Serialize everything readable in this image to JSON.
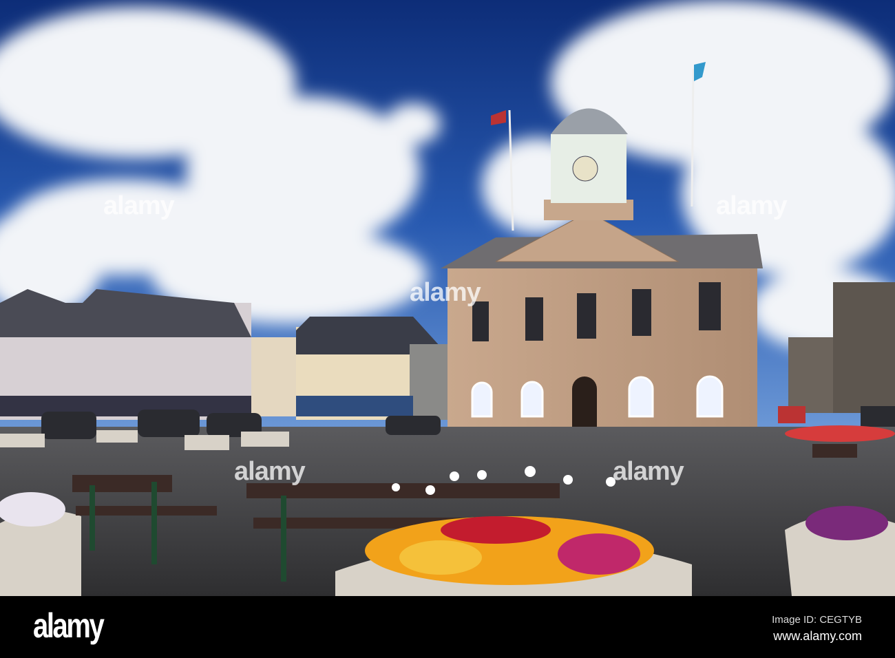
{
  "watermarks": [
    "alamy",
    "alamy",
    "alamy",
    "alamy",
    "alamy"
  ],
  "footer": {
    "logo": "alamy",
    "image_id": "Image ID: CEGTYB",
    "website": "www.alamy.com"
  }
}
